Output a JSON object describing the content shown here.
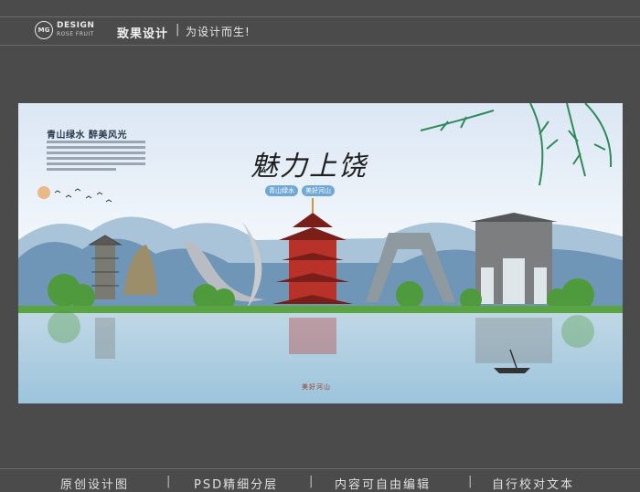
{
  "header": {
    "logo_badge": "MG",
    "logo_line1": "DESIGN",
    "logo_line2": "ROSE FRUIT",
    "brand": "致果设计",
    "separator": "|",
    "slogan": "为设计而生!"
  },
  "poster": {
    "subtitle": "青山绿水 醉美风光",
    "title": "魅力上饶",
    "tags": [
      "青山绿水",
      "美好河山"
    ],
    "footer_text": "美好河山",
    "colors": {
      "sky": "#dbe7f4",
      "water": "#9cc4dc",
      "mountain": "#5f88a8",
      "accent_red": "#b8322a"
    }
  },
  "footer": {
    "items": [
      "原创设计图",
      "PSD精细分层",
      "内容可自由编辑",
      "自行校对文本"
    ],
    "separator": "|"
  }
}
